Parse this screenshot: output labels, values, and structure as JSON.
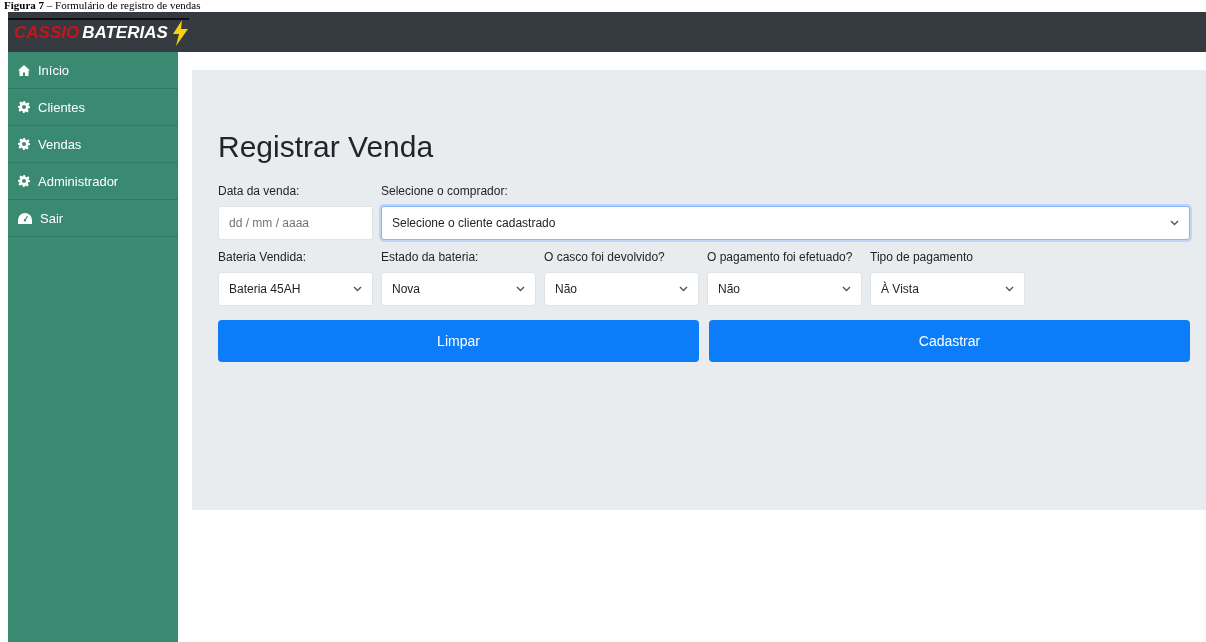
{
  "caption": "**Figura 7** – Formulário de registro de vendas",
  "header": {
    "logo_red": "CASSIO",
    "logo_white": "BATERIAS"
  },
  "sidebar": {
    "items": [
      {
        "label": "Início"
      },
      {
        "label": "Clientes"
      },
      {
        "label": "Vendas"
      },
      {
        "label": "Administrador"
      },
      {
        "label": "Sair"
      }
    ]
  },
  "form": {
    "title": "Registrar Venda",
    "rows": [
      [
        {
          "kind": "date",
          "label": "Data da venda:",
          "placeholder": "dd / mm / aaaa"
        },
        {
          "kind": "select",
          "label": "Selecione o comprador:",
          "value": "Selecione o cliente cadastrado",
          "focused": true
        }
      ],
      [
        {
          "kind": "select",
          "label": "Bateria Vendida:",
          "value": "Bateria 45AH",
          "focused": false
        },
        {
          "kind": "select",
          "label": "Estado da bateria:",
          "value": "Nova",
          "focused": false
        },
        {
          "kind": "select",
          "label": "O casco foi devolvido?",
          "value": "Não",
          "focused": false
        },
        {
          "kind": "select",
          "label": "O pagamento foi efetuado?",
          "value": "Não",
          "focused": false
        },
        {
          "kind": "select",
          "label": "Tipo de pagamento",
          "value": "À Vista",
          "focused": false
        }
      ]
    ],
    "buttons": [
      "Limpar",
      "Cadastrar"
    ]
  }
}
